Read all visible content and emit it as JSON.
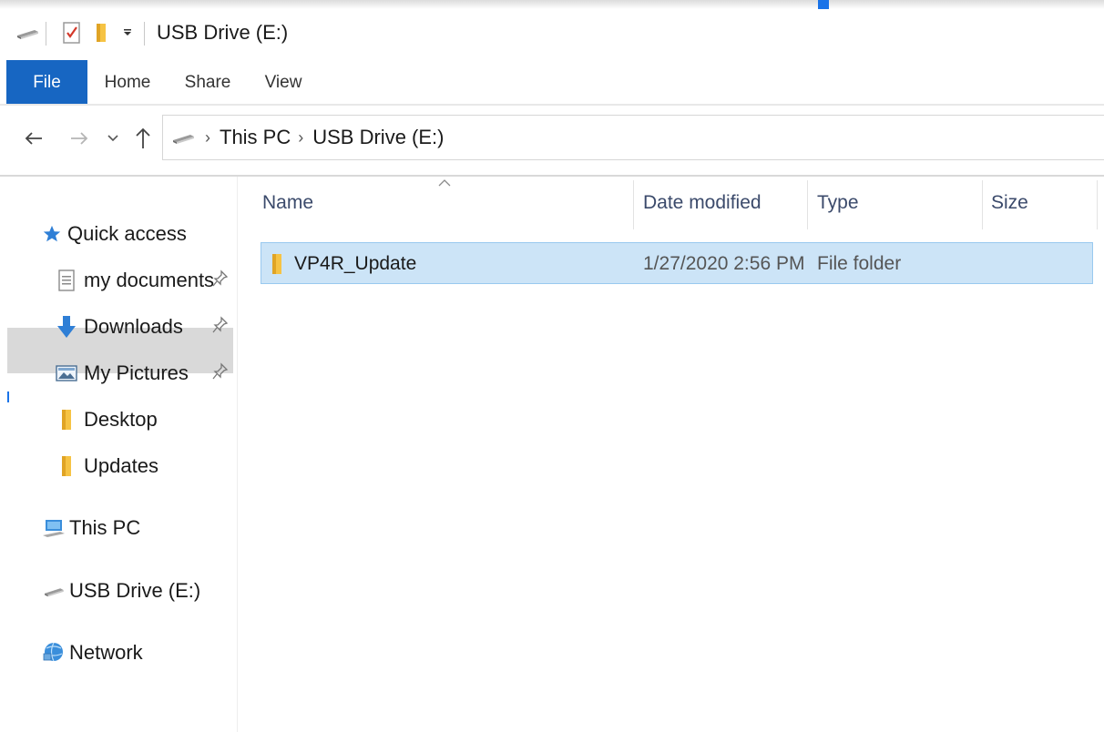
{
  "window": {
    "title": "USB Drive (E:)"
  },
  "quick_access_toolbar": {
    "icons": [
      "drive-icon",
      "properties-checkbox-icon",
      "folder-icon",
      "customize-dropdown-icon"
    ]
  },
  "ribbon": {
    "tabs": [
      {
        "label": "File",
        "active": true
      },
      {
        "label": "Home"
      },
      {
        "label": "Share"
      },
      {
        "label": "View"
      }
    ],
    "file_tab_color": "#1766c2"
  },
  "navigation": {
    "back_icon": "arrow-left-icon",
    "forward_icon": "arrow-right-icon",
    "recent_icon": "chevron-down-icon",
    "up_icon": "arrow-up-icon"
  },
  "address_bar": {
    "icon": "drive-icon",
    "crumbs": [
      "This PC",
      "USB Drive (E:)"
    ]
  },
  "nav_pane": {
    "quick_access": {
      "label": "Quick access",
      "icon": "star-icon"
    },
    "items": [
      {
        "label": "my documents",
        "icon": "document-icon",
        "pinned": true
      },
      {
        "label": "Downloads",
        "icon": "download-arrow-icon",
        "pinned": true
      },
      {
        "label": "My Pictures",
        "icon": "pictures-icon",
        "pinned": true
      },
      {
        "label": "Desktop",
        "icon": "folder-icon",
        "pinned": false
      },
      {
        "label": "Updates",
        "icon": "folder-icon",
        "pinned": false
      }
    ],
    "this_pc": {
      "label": "This PC",
      "icon": "computer-icon",
      "selected": true
    },
    "usb_drive": {
      "label": "USB Drive (E:)",
      "icon": "drive-icon"
    },
    "network": {
      "label": "Network",
      "icon": "network-icon"
    }
  },
  "file_list": {
    "columns": [
      "Name",
      "Date modified",
      "Type",
      "Size"
    ],
    "sort_column": "Name",
    "rows": [
      {
        "name": "VP4R_Update",
        "date_modified": "1/27/2020 2:56 PM",
        "type": "File folder",
        "size": "",
        "icon": "folder-icon",
        "selected": true
      }
    ],
    "selection_color": "#cce4f7"
  }
}
